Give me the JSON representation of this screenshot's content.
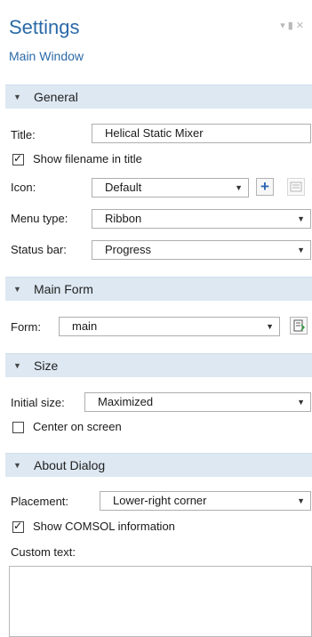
{
  "header": {
    "title": "Settings",
    "subtitle": "Main Window"
  },
  "general": {
    "section_label": "General",
    "title_label": "Title:",
    "title_value": "Helical Static Mixer",
    "show_filename_label": "Show filename in title",
    "show_filename_checked": true,
    "icon_label": "Icon:",
    "icon_value": "Default",
    "menu_type_label": "Menu type:",
    "menu_type_value": "Ribbon",
    "status_bar_label": "Status bar:",
    "status_bar_value": "Progress"
  },
  "main_form": {
    "section_label": "Main Form",
    "form_label": "Form:",
    "form_value": "main"
  },
  "size": {
    "section_label": "Size",
    "initial_size_label": "Initial size:",
    "initial_size_value": "Maximized",
    "center_label": "Center on screen",
    "center_checked": false
  },
  "about": {
    "section_label": "About Dialog",
    "placement_label": "Placement:",
    "placement_value": "Lower-right corner",
    "show_comsol_label": "Show COMSOL information",
    "show_comsol_checked": true,
    "custom_text_label": "Custom text:",
    "custom_text_value": ""
  },
  "icons": {
    "collapse": "triangle-down",
    "dropdown": "chevron-down",
    "add": "plus",
    "edit": "edit-icon",
    "form_action": "form-icon",
    "window_controls": "pin-close"
  },
  "colors": {
    "accent": "#2b6aa8",
    "section_bg": "#dde8f2"
  }
}
